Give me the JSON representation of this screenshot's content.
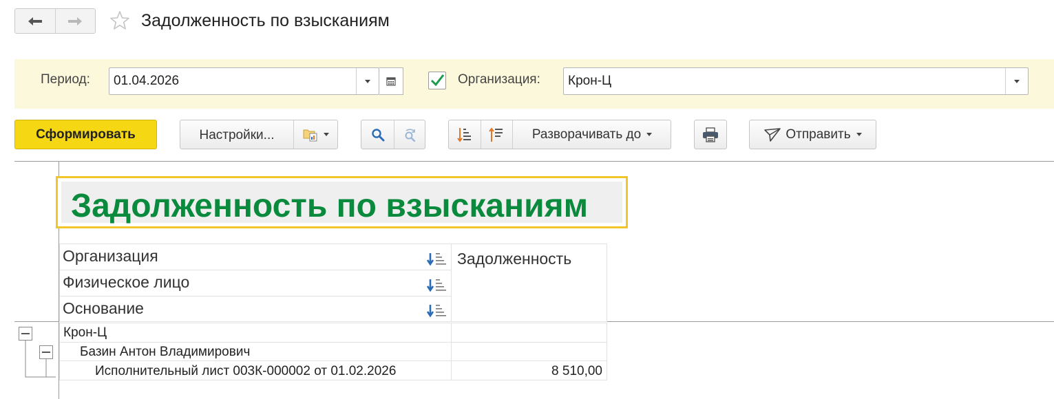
{
  "window": {
    "title": "Задолженность по взысканиям"
  },
  "filters": {
    "period_label": "Период:",
    "period_value": "01.04.2026",
    "org_checked": true,
    "org_label": "Организация:",
    "org_value": "Крон-Ц"
  },
  "toolbar": {
    "generate_label": "Сформировать",
    "settings_label": "Настройки...",
    "expand_label": "Разворачивать до",
    "send_label": "Отправить"
  },
  "report": {
    "title": "Задолженность по взысканиям",
    "headers": {
      "organization": "Организация",
      "person": "Физическое лицо",
      "basis": "Основание",
      "debt": "Задолженность"
    },
    "rows": [
      {
        "label": "Крон-Ц",
        "value": ""
      },
      {
        "label": "Базин Антон Владимирович",
        "value": ""
      },
      {
        "label": "Исполнительный лист 003К-000002 от 01.02.2026",
        "value": "8 510,00"
      }
    ]
  },
  "colors": {
    "accent_yellow": "#f5d813",
    "title_green": "#0a8a3c",
    "filter_bg": "#fcf8dc",
    "check_green": "#1a9b4b",
    "icon_blue": "#2a6cb5",
    "icon_orange": "#e0782a"
  }
}
